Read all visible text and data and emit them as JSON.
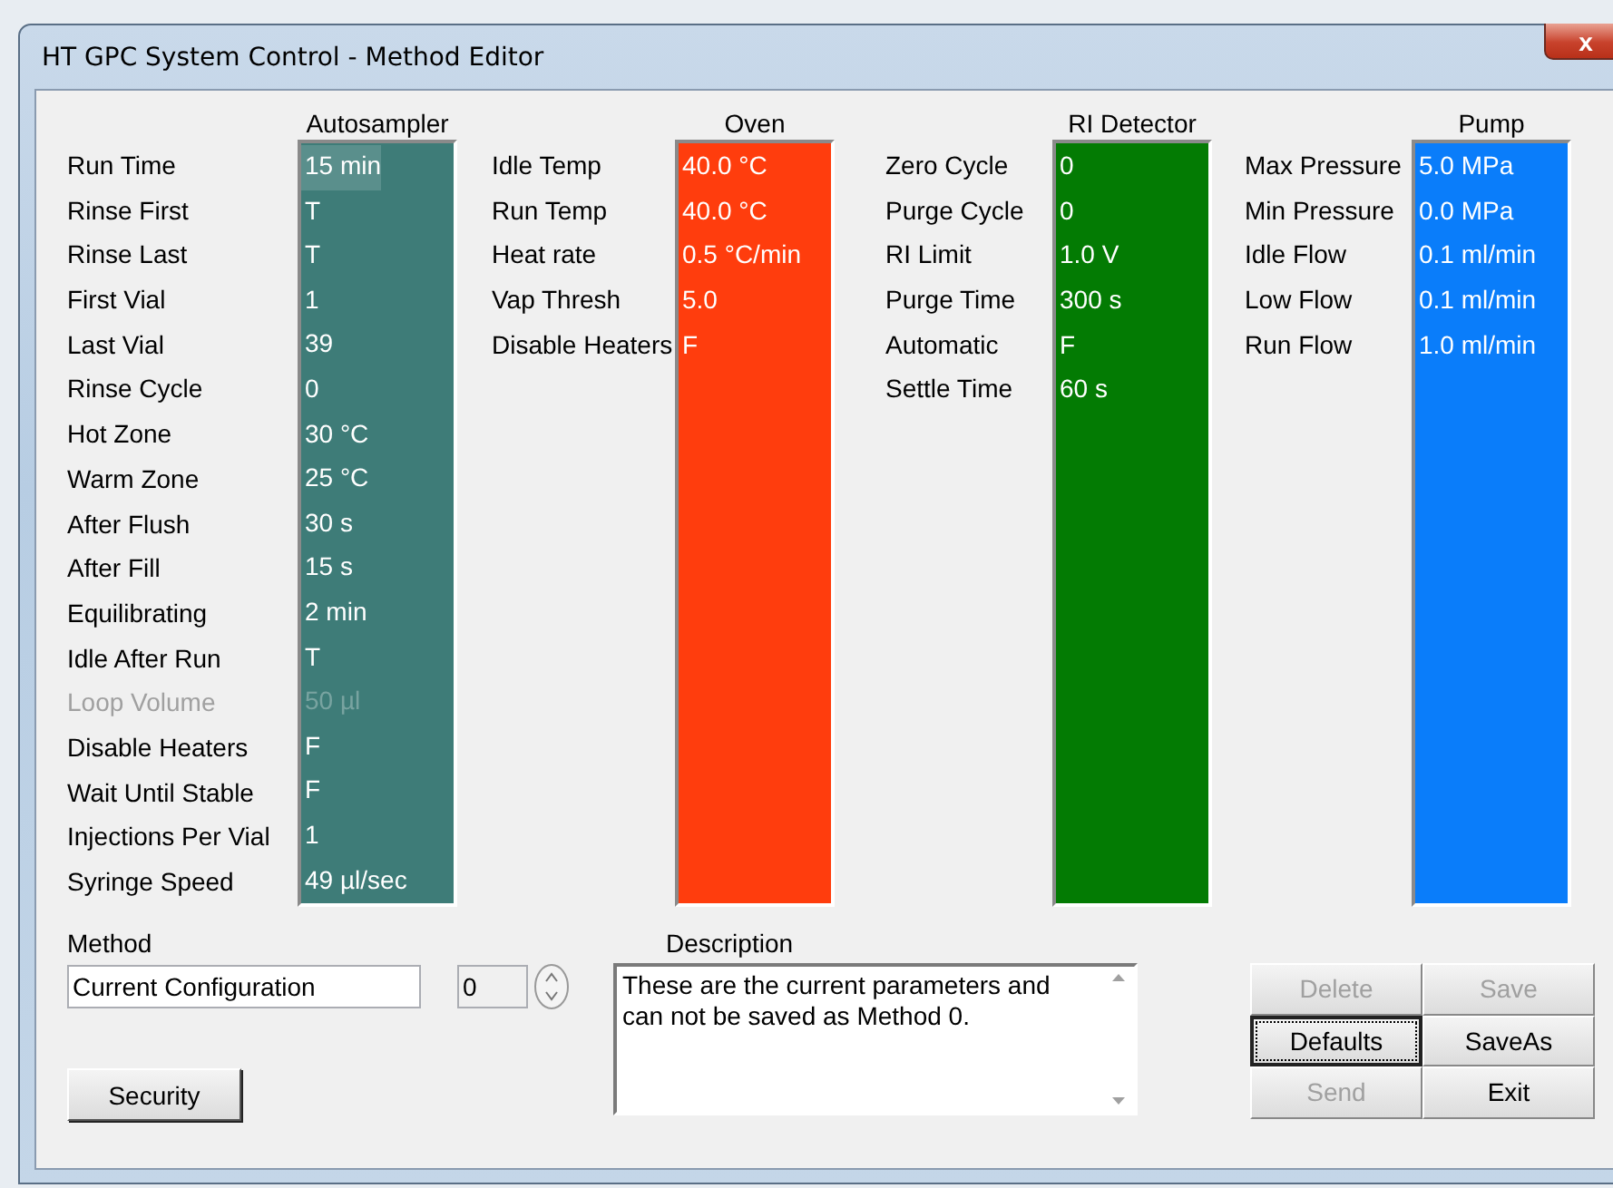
{
  "window": {
    "title": "HT GPC System Control - Method Editor",
    "close": "x"
  },
  "sections": [
    {
      "title": "Autosampler",
      "color": "#3e7c78",
      "rows": [
        {
          "label": "Run Time",
          "value": "15 min",
          "disabled": false,
          "selected": true
        },
        {
          "label": "Rinse First",
          "value": "T",
          "disabled": false,
          "selected": false
        },
        {
          "label": "Rinse Last",
          "value": "T",
          "disabled": false,
          "selected": false
        },
        {
          "label": "First Vial",
          "value": "1",
          "disabled": false,
          "selected": false
        },
        {
          "label": "Last Vial",
          "value": "39",
          "disabled": false,
          "selected": false
        },
        {
          "label": "Rinse Cycle",
          "value": "0",
          "disabled": false,
          "selected": false
        },
        {
          "label": "Hot Zone",
          "value": "30 °C",
          "disabled": false,
          "selected": false
        },
        {
          "label": "Warm Zone",
          "value": "25 °C",
          "disabled": false,
          "selected": false
        },
        {
          "label": "After Flush",
          "value": "30 s",
          "disabled": false,
          "selected": false
        },
        {
          "label": "After Fill",
          "value": "15 s",
          "disabled": false,
          "selected": false
        },
        {
          "label": "Equilibrating",
          "value": "2 min",
          "disabled": false,
          "selected": false
        },
        {
          "label": "Idle After Run",
          "value": "T",
          "disabled": false,
          "selected": false
        },
        {
          "label": "Loop Volume",
          "value": "50 µl",
          "disabled": true,
          "selected": false
        },
        {
          "label": "Disable Heaters",
          "value": "F",
          "disabled": false,
          "selected": false
        },
        {
          "label": "Wait Until Stable",
          "value": "F",
          "disabled": false,
          "selected": false
        },
        {
          "label": "Injections Per Vial",
          "value": "1",
          "disabled": false,
          "selected": false
        },
        {
          "label": "Syringe Speed",
          "value": "49 µl/sec",
          "disabled": false,
          "selected": false
        }
      ]
    },
    {
      "title": "Oven",
      "color": "#ff3d0d",
      "rows": [
        {
          "label": "Idle Temp",
          "value": "40.0 °C",
          "disabled": false,
          "selected": false
        },
        {
          "label": "Run Temp",
          "value": "40.0 °C",
          "disabled": false,
          "selected": false
        },
        {
          "label": "Heat rate",
          "value": "0.5 °C/min",
          "disabled": false,
          "selected": false
        },
        {
          "label": "Vap Thresh",
          "value": "5.0",
          "disabled": false,
          "selected": false
        },
        {
          "label": "Disable Heaters",
          "value": "F",
          "disabled": false,
          "selected": false
        }
      ]
    },
    {
      "title": "RI Detector",
      "color": "#037b03",
      "rows": [
        {
          "label": "Zero Cycle",
          "value": "0",
          "disabled": false,
          "selected": false
        },
        {
          "label": "Purge Cycle",
          "value": "0",
          "disabled": false,
          "selected": false
        },
        {
          "label": "RI Limit",
          "value": "1.0 V",
          "disabled": false,
          "selected": false
        },
        {
          "label": "Purge Time",
          "value": "300 s",
          "disabled": false,
          "selected": false
        },
        {
          "label": "Automatic",
          "value": "F",
          "disabled": false,
          "selected": false
        },
        {
          "label": "Settle Time",
          "value": "60 s",
          "disabled": false,
          "selected": false
        }
      ]
    },
    {
      "title": "Pump",
      "color": "#0a7dfa",
      "rows": [
        {
          "label": "Max Pressure",
          "value": "5.0 MPa",
          "disabled": false,
          "selected": false
        },
        {
          "label": "Min Pressure",
          "value": "0.0 MPa",
          "disabled": false,
          "selected": false
        },
        {
          "label": "Idle Flow",
          "value": "0.1 ml/min",
          "disabled": false,
          "selected": false
        },
        {
          "label": "Low Flow",
          "value": "0.1 ml/min",
          "disabled": false,
          "selected": false
        },
        {
          "label": "Run Flow",
          "value": "1.0 ml/min",
          "disabled": false,
          "selected": false
        }
      ]
    }
  ],
  "method": {
    "label": "Method",
    "value": "Current Configuration",
    "number": "0"
  },
  "security_button": "Security",
  "description": {
    "label": "Description",
    "value": "These are the current parameters and can not be saved as Method 0."
  },
  "buttons": [
    {
      "label": "Delete",
      "disabled": true,
      "focused": false
    },
    {
      "label": "Save",
      "disabled": true,
      "focused": false
    },
    {
      "label": "Defaults",
      "disabled": false,
      "focused": true
    },
    {
      "label": "SaveAs",
      "disabled": false,
      "focused": false
    },
    {
      "label": "Send",
      "disabled": true,
      "focused": false
    },
    {
      "label": "Exit",
      "disabled": false,
      "focused": false
    }
  ]
}
